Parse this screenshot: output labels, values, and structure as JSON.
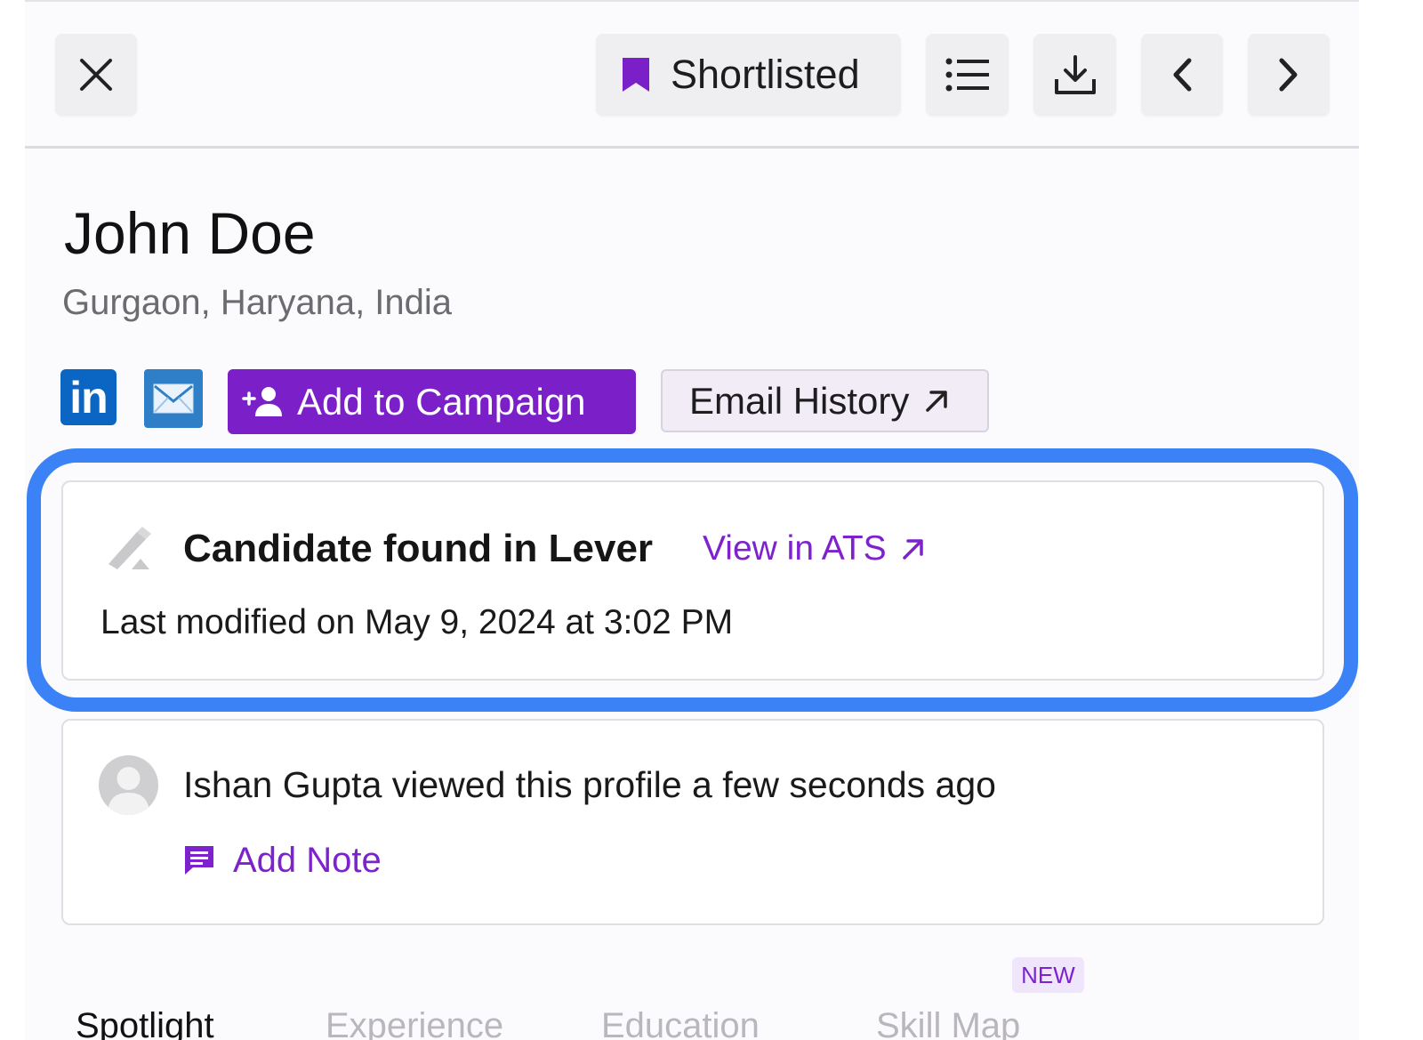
{
  "toolbar": {
    "close_icon": "close-icon",
    "shortlist_label": "Shortlisted",
    "shortlist_color": "#7b1fc9",
    "list_icon": "list-icon",
    "download_icon": "download-icon",
    "prev_icon": "chevron-left-icon",
    "next_icon": "chevron-right-icon"
  },
  "profile": {
    "name": "John Doe",
    "location": "Gurgaon, Haryana, India",
    "linkedin_label": "in"
  },
  "actions": {
    "campaign_label": "Add to Campaign",
    "campaign_color": "#7b1fc9",
    "email_history_label": "Email History"
  },
  "ats_card": {
    "title": "Candidate found in Lever",
    "link_label": "View in ATS",
    "modified": "Last modified on May 9, 2024 at 3:02 PM",
    "highlight_color": "#3b82f6"
  },
  "activity_card": {
    "viewed_text": "Ishan Gupta viewed this profile a few seconds ago",
    "add_note_label": "Add Note"
  },
  "tabs": {
    "new_badge": "NEW",
    "items": [
      {
        "label": "Spotlight"
      },
      {
        "label": "Experience"
      },
      {
        "label": "Education"
      },
      {
        "label": "Skill Map"
      }
    ]
  }
}
